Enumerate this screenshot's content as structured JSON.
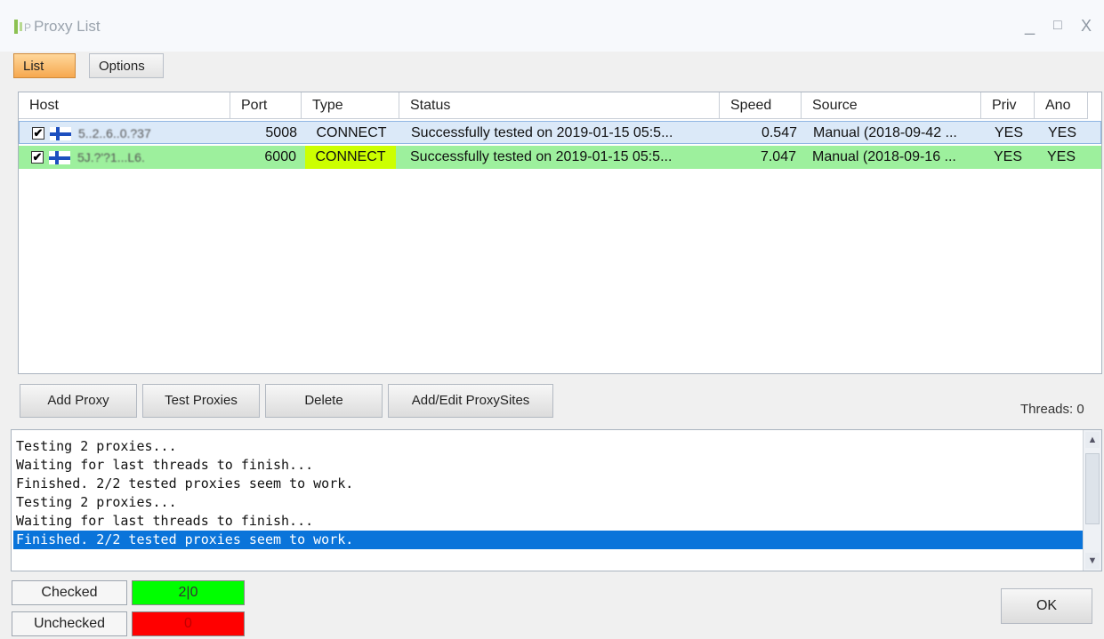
{
  "window": {
    "title": "Proxy List",
    "controls": {
      "minimize": "_",
      "maximize": "□",
      "close": "X"
    }
  },
  "menu": {
    "list_label": "List",
    "options_label": "Options"
  },
  "table": {
    "columns": [
      "Host",
      "Port",
      "Type",
      "Status",
      "Speed",
      "Source",
      "Priv",
      "Ano"
    ],
    "rows": [
      {
        "checked": "✔",
        "host": "5..2..6..0.?37",
        "port": "5008",
        "type": "CONNECT",
        "status": "Successfully tested on 2019-01-15 05:5...",
        "speed": "0.547",
        "source": "Manual (2018-09-42 ...",
        "priv": "YES",
        "ano": "YES"
      },
      {
        "checked": "✔",
        "host": "5J.?'?1...L6.",
        "port": "6000",
        "type": "CONNECT",
        "status": "Successfully tested on 2019-01-15 05:5...",
        "speed": "7.047",
        "source": "Manual (2018-09-16 ...",
        "priv": "YES",
        "ano": "YES"
      }
    ]
  },
  "actions": {
    "add_proxy": "Add Proxy",
    "test_proxies": "Test Proxies",
    "delete": "Delete",
    "add_edit_proxysites": "Add/Edit ProxySites"
  },
  "threads_label": "Threads: 0",
  "log": {
    "lines": [
      "Testing 2 proxies...",
      "Waiting for last threads to finish...",
      "Finished. 2/2 tested proxies seem to work.",
      "Testing 2 proxies...",
      "Waiting for last threads to finish...",
      "Finished. 2/2 tested proxies seem to work."
    ],
    "selected_index": 5
  },
  "stats": {
    "checked_label": "Checked",
    "checked_value": "2|0",
    "unchecked_label": "Unchecked",
    "unchecked_value": "0"
  },
  "ok_label": "OK",
  "colors": {
    "selected_row": "#dbe9f8",
    "good_row": "#90ee90",
    "type_highlight": "#ccff00",
    "checked_box": "#00ff00",
    "unchecked_box": "#ff0000",
    "log_selection": "#0a74da",
    "active_tab": "#f6a84f"
  }
}
